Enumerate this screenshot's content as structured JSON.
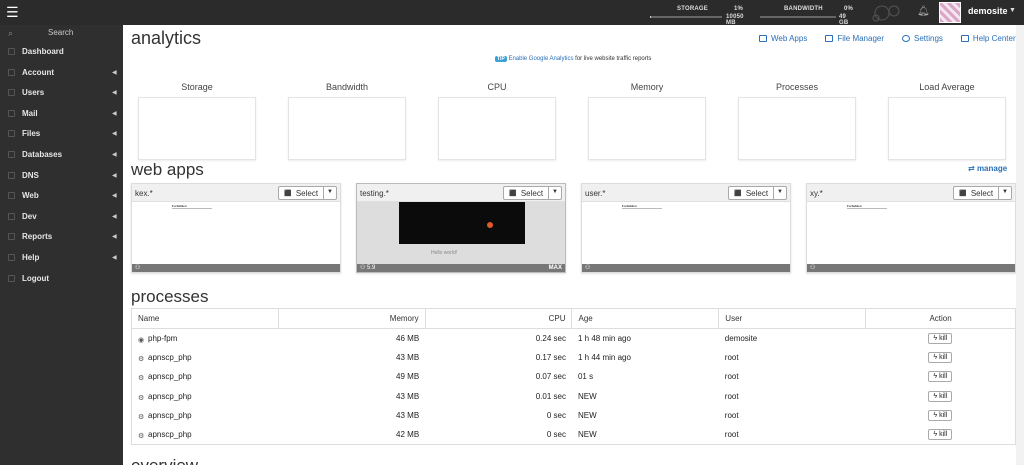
{
  "topbar": {
    "storage_label": "STORAGE",
    "storage_pct": "1%",
    "storage_total": "10050 MB",
    "storage_fraction": 0.01,
    "bandwidth_label": "BANDWIDTH",
    "bandwidth_pct": "0%",
    "bandwidth_total": "49 GB",
    "bandwidth_fraction": 0.0,
    "username": "demosite"
  },
  "sidebar": {
    "search_label": "Search",
    "items": [
      {
        "label": "Dashboard",
        "has_caret": false
      },
      {
        "label": "Account",
        "has_caret": true
      },
      {
        "label": "Users",
        "has_caret": true
      },
      {
        "label": "Mail",
        "has_caret": true
      },
      {
        "label": "Files",
        "has_caret": true
      },
      {
        "label": "Databases",
        "has_caret": true
      },
      {
        "label": "DNS",
        "has_caret": true
      },
      {
        "label": "Web",
        "has_caret": true
      },
      {
        "label": "Dev",
        "has_caret": true
      },
      {
        "label": "Reports",
        "has_caret": true
      },
      {
        "label": "Help",
        "has_caret": true
      },
      {
        "label": "Logout",
        "has_caret": false
      }
    ]
  },
  "main": {
    "title": "analytics",
    "quick_links": {
      "web_apps": "Web Apps",
      "file_manager": "File Manager",
      "settings": "Settings",
      "help_center": "Help Center"
    },
    "tip": {
      "tag": "TIP",
      "link": "Enable Google Analytics",
      "text": " for live website traffic reports"
    },
    "stats": [
      "Storage",
      "Bandwidth",
      "CPU",
      "Memory",
      "Processes",
      "Load Average"
    ],
    "web_apps_title": "web apps",
    "manage_label": "manage",
    "apps": [
      {
        "name": "kex.*",
        "select": "Select",
        "footer": "",
        "max": "",
        "thumb_title": "Forbidden"
      },
      {
        "name": "testing.*",
        "select": "Select",
        "footer": "5.9",
        "max": "MAX",
        "thumb_title": "Hello world!"
      },
      {
        "name": "user.*",
        "select": "Select",
        "footer": "",
        "max": "",
        "thumb_title": "Forbidden"
      },
      {
        "name": "xy.*",
        "select": "Select",
        "footer": "",
        "max": "",
        "thumb_title": "Forbidden"
      }
    ],
    "processes_title": "processes",
    "process_headers": [
      "Name",
      "Memory",
      "CPU",
      "Age",
      "User",
      "Action"
    ],
    "processes": [
      {
        "name": "php-fpm",
        "memory": "46 MB",
        "cpu": "0.24 sec",
        "age": "1 h 48 min ago",
        "user": "demosite",
        "action": "kill",
        "icon": "eye-icon"
      },
      {
        "name": "apnscp_php",
        "memory": "43 MB",
        "cpu": "0.17 sec",
        "age": "1 h 44 min ago",
        "user": "root",
        "action": "kill",
        "icon": "gears-icon"
      },
      {
        "name": "apnscp_php",
        "memory": "49 MB",
        "cpu": "0.07 sec",
        "age": "01 s",
        "user": "root",
        "action": "kill",
        "icon": "gears-icon"
      },
      {
        "name": "apnscp_php",
        "memory": "43 MB",
        "cpu": "0.01 sec",
        "age": "NEW",
        "user": "root",
        "action": "kill",
        "icon": "gears-icon"
      },
      {
        "name": "apnscp_php",
        "memory": "43 MB",
        "cpu": "0 sec",
        "age": "NEW",
        "user": "root",
        "action": "kill",
        "icon": "gears-icon"
      },
      {
        "name": "apnscp_php",
        "memory": "42 MB",
        "cpu": "0 sec",
        "age": "NEW",
        "user": "root",
        "action": "kill",
        "icon": "gears-icon"
      }
    ],
    "overview_title": "overview"
  }
}
